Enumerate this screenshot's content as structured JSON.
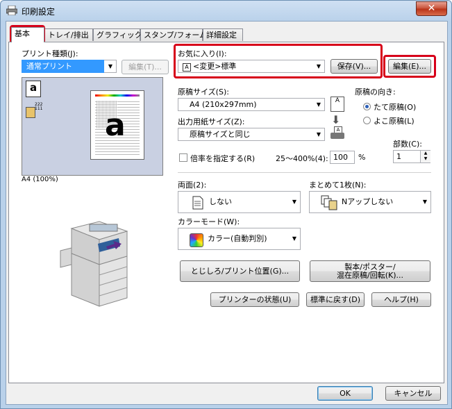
{
  "window": {
    "title": "印刷設定",
    "close_glyph": "✕"
  },
  "tabs": [
    {
      "label": "基本"
    },
    {
      "label": "トレイ/排出"
    },
    {
      "label": "グラフィックス"
    },
    {
      "label": "スタンプ/フォーム"
    },
    {
      "label": "詳細設定"
    }
  ],
  "print_type": {
    "label": "プリント種類(J):",
    "value": "通常プリント",
    "edit_label": "編集(T)..."
  },
  "preview": {
    "caption": "A4 (100%)",
    "paper_letter": "a",
    "icon_a": "a",
    "icon_numbers": "222\n111"
  },
  "favorites": {
    "label": "お気に入り(I):",
    "value": "<変更>標準",
    "save_label": "保存(V)...",
    "edit_label": "編集(E)..."
  },
  "paper_size": {
    "label": "原稿サイズ(S):",
    "value": "A4 (210x297mm)"
  },
  "output_size": {
    "label": "出力用紙サイズ(Z):",
    "value": "原稿サイズと同じ"
  },
  "orientation": {
    "label": "原稿の向き:",
    "options": [
      {
        "label": "たて原稿(O)",
        "selected": true
      },
      {
        "label": "よこ原稿(L)",
        "selected": false
      }
    ]
  },
  "scale": {
    "label": "倍率を指定する(R)",
    "checked": false,
    "range_label": "25～400%(4):",
    "value": "100",
    "unit": "%"
  },
  "copies": {
    "label": "部数(C):",
    "value": "1"
  },
  "duplex": {
    "label": "両面(2):",
    "value": "しない"
  },
  "nup": {
    "label": "まとめて1枚(N):",
    "value": "Nアップしない"
  },
  "color_mode": {
    "label": "カラーモード(W):",
    "value": "カラー(自動判別)"
  },
  "buttons": {
    "binding": "とじしろ/プリント位置(G)...",
    "booklet_line1": "製本/ポスター/",
    "booklet_line2": "混在原稿/回転(K)...",
    "printer_status": "プリンターの状態(U)",
    "defaults": "標準に戻す(D)",
    "help": "ヘルプ(H)",
    "ok": "OK",
    "cancel": "キャンセル"
  },
  "colors": {
    "highlight": "#d7001a",
    "selection": "#3399ff"
  }
}
